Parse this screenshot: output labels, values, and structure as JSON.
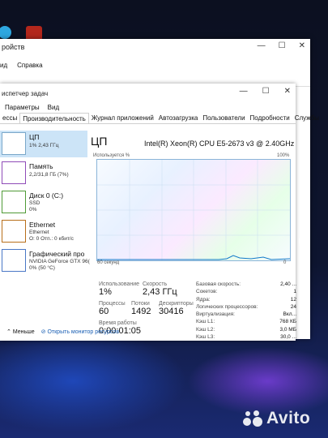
{
  "background_window": {
    "title": "ройств",
    "menu": [
      "ид",
      "Справка"
    ],
    "controls": [
      "—",
      "☐",
      "✕"
    ]
  },
  "task_manager": {
    "title": "испетчер задач",
    "controls": [
      "—",
      "☐",
      "✕"
    ],
    "menu": [
      "Параметры",
      "Вид"
    ],
    "tabs": [
      "ессы",
      "Производительность",
      "Журнал приложений",
      "Автозагрузка",
      "Пользователи",
      "Подробности",
      "Службы"
    ],
    "active_tab": "Производительность",
    "sidebar": [
      {
        "name": "ЦП",
        "line1": "1% 2,43 ГГц",
        "line2": ""
      },
      {
        "name": "Память",
        "line1": "2,2/31,8 ГБ (7%)",
        "line2": ""
      },
      {
        "name": "Диск 0 (C:)",
        "line1": "SSD",
        "line2": "0%"
      },
      {
        "name": "Ethernet",
        "line1": "Ethernet",
        "line2": "О: 0 Отп.: 0 кбит/с"
      },
      {
        "name": "Графический про",
        "line1": "NVIDIA GeForce GTX 96(",
        "line2": "0% (50 °C)"
      }
    ],
    "cpu": {
      "heading": "ЦП",
      "model": "Intel(R) Xeon(R) CPU E5-2673 v3 @ 2.40GHz",
      "graph_label_left": "Используется %",
      "graph_label_right": "100%",
      "graph_bottom_left": "60 секунд",
      "graph_bottom_right": "0",
      "utilization_label": "Использование",
      "utilization_value": "1%",
      "speed_label": "Скорость",
      "speed_value": "2,43 ГГц",
      "processes_label": "Процессы",
      "processes_value": "60",
      "threads_label": "Потоки",
      "threads_value": "1492",
      "handles_label": "Дескрипторы",
      "handles_value": "30416",
      "uptime_label": "Время работы",
      "uptime_value": "0:00:01:05",
      "specs": [
        {
          "label": "Базовая скорость:",
          "value": "2,40 ..."
        },
        {
          "label": "Сокетов:",
          "value": "1"
        },
        {
          "label": "Ядра:",
          "value": "12"
        },
        {
          "label": "Логических процессоров:",
          "value": "24"
        },
        {
          "label": "Виртуализация:",
          "value": "Вкл..."
        },
        {
          "label": "Кэш L1:",
          "value": "768 КБ"
        },
        {
          "label": "Кэш L2:",
          "value": "3,0 МБ"
        },
        {
          "label": "Кэш L3:",
          "value": "30,0 ..."
        }
      ]
    },
    "footer": {
      "less_label": "Меньше",
      "monitor_label": "Открыть монитор ресурсов"
    }
  },
  "watermark": "Avito",
  "colors": {
    "accent": "#0078d4",
    "selected": "#cce4f7"
  }
}
